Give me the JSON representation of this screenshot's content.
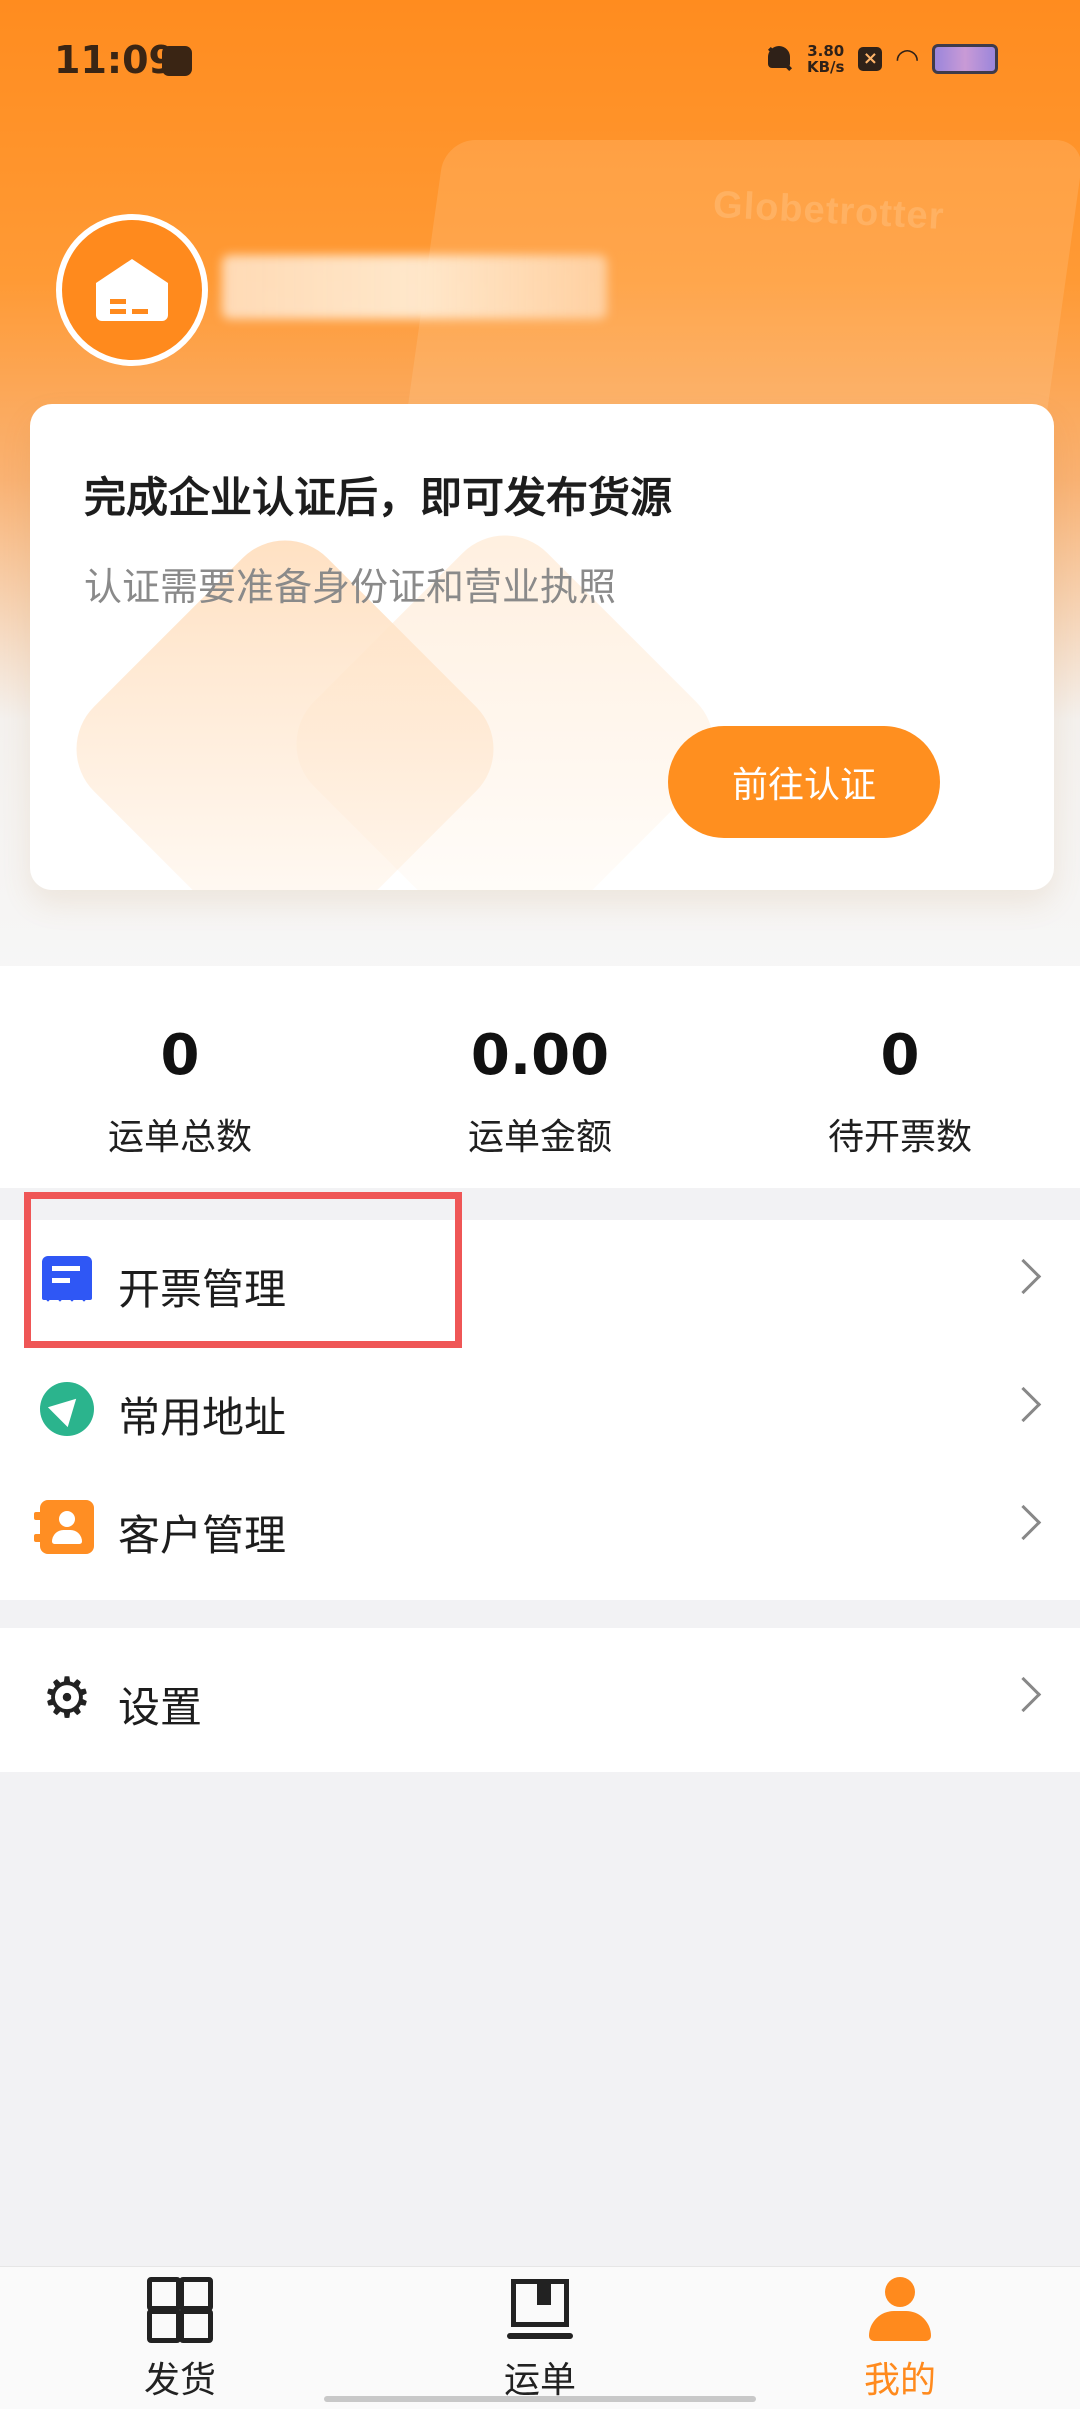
{
  "status_bar": {
    "time": "11:09",
    "speed_value": "3.80",
    "speed_unit": "KB/s",
    "icons": [
      "app-notification-icon",
      "bell-muted-icon",
      "close-box-icon",
      "wifi-icon",
      "battery-icon"
    ]
  },
  "colors": {
    "accent": "#ff8a1d",
    "invoice_icon": "#2f57f5",
    "address_icon": "#2bb48d",
    "highlight": "#ef5656"
  },
  "auth_card": {
    "title": "完成企业认证后，即可发布货源",
    "subtitle": "认证需要准备身份证和营业执照",
    "button_label": "前往认证"
  },
  "stats": [
    {
      "value": "0",
      "label": "运单总数"
    },
    {
      "value": "0.00",
      "label": "运单金额"
    },
    {
      "value": "0",
      "label": "待开票数"
    }
  ],
  "menu": [
    {
      "label": "开票管理",
      "icon": "invoice-icon"
    },
    {
      "label": "常用地址",
      "icon": "navigation-icon"
    },
    {
      "label": "客户管理",
      "icon": "contact-card-icon"
    }
  ],
  "settings": {
    "label": "设置",
    "icon": "gear-icon"
  },
  "tabbar": {
    "tabs": [
      {
        "label": "发货",
        "icon": "grid-icon"
      },
      {
        "label": "运单",
        "icon": "book-icon"
      },
      {
        "label": "我的",
        "icon": "person-icon"
      }
    ],
    "active_tab": "我的"
  }
}
